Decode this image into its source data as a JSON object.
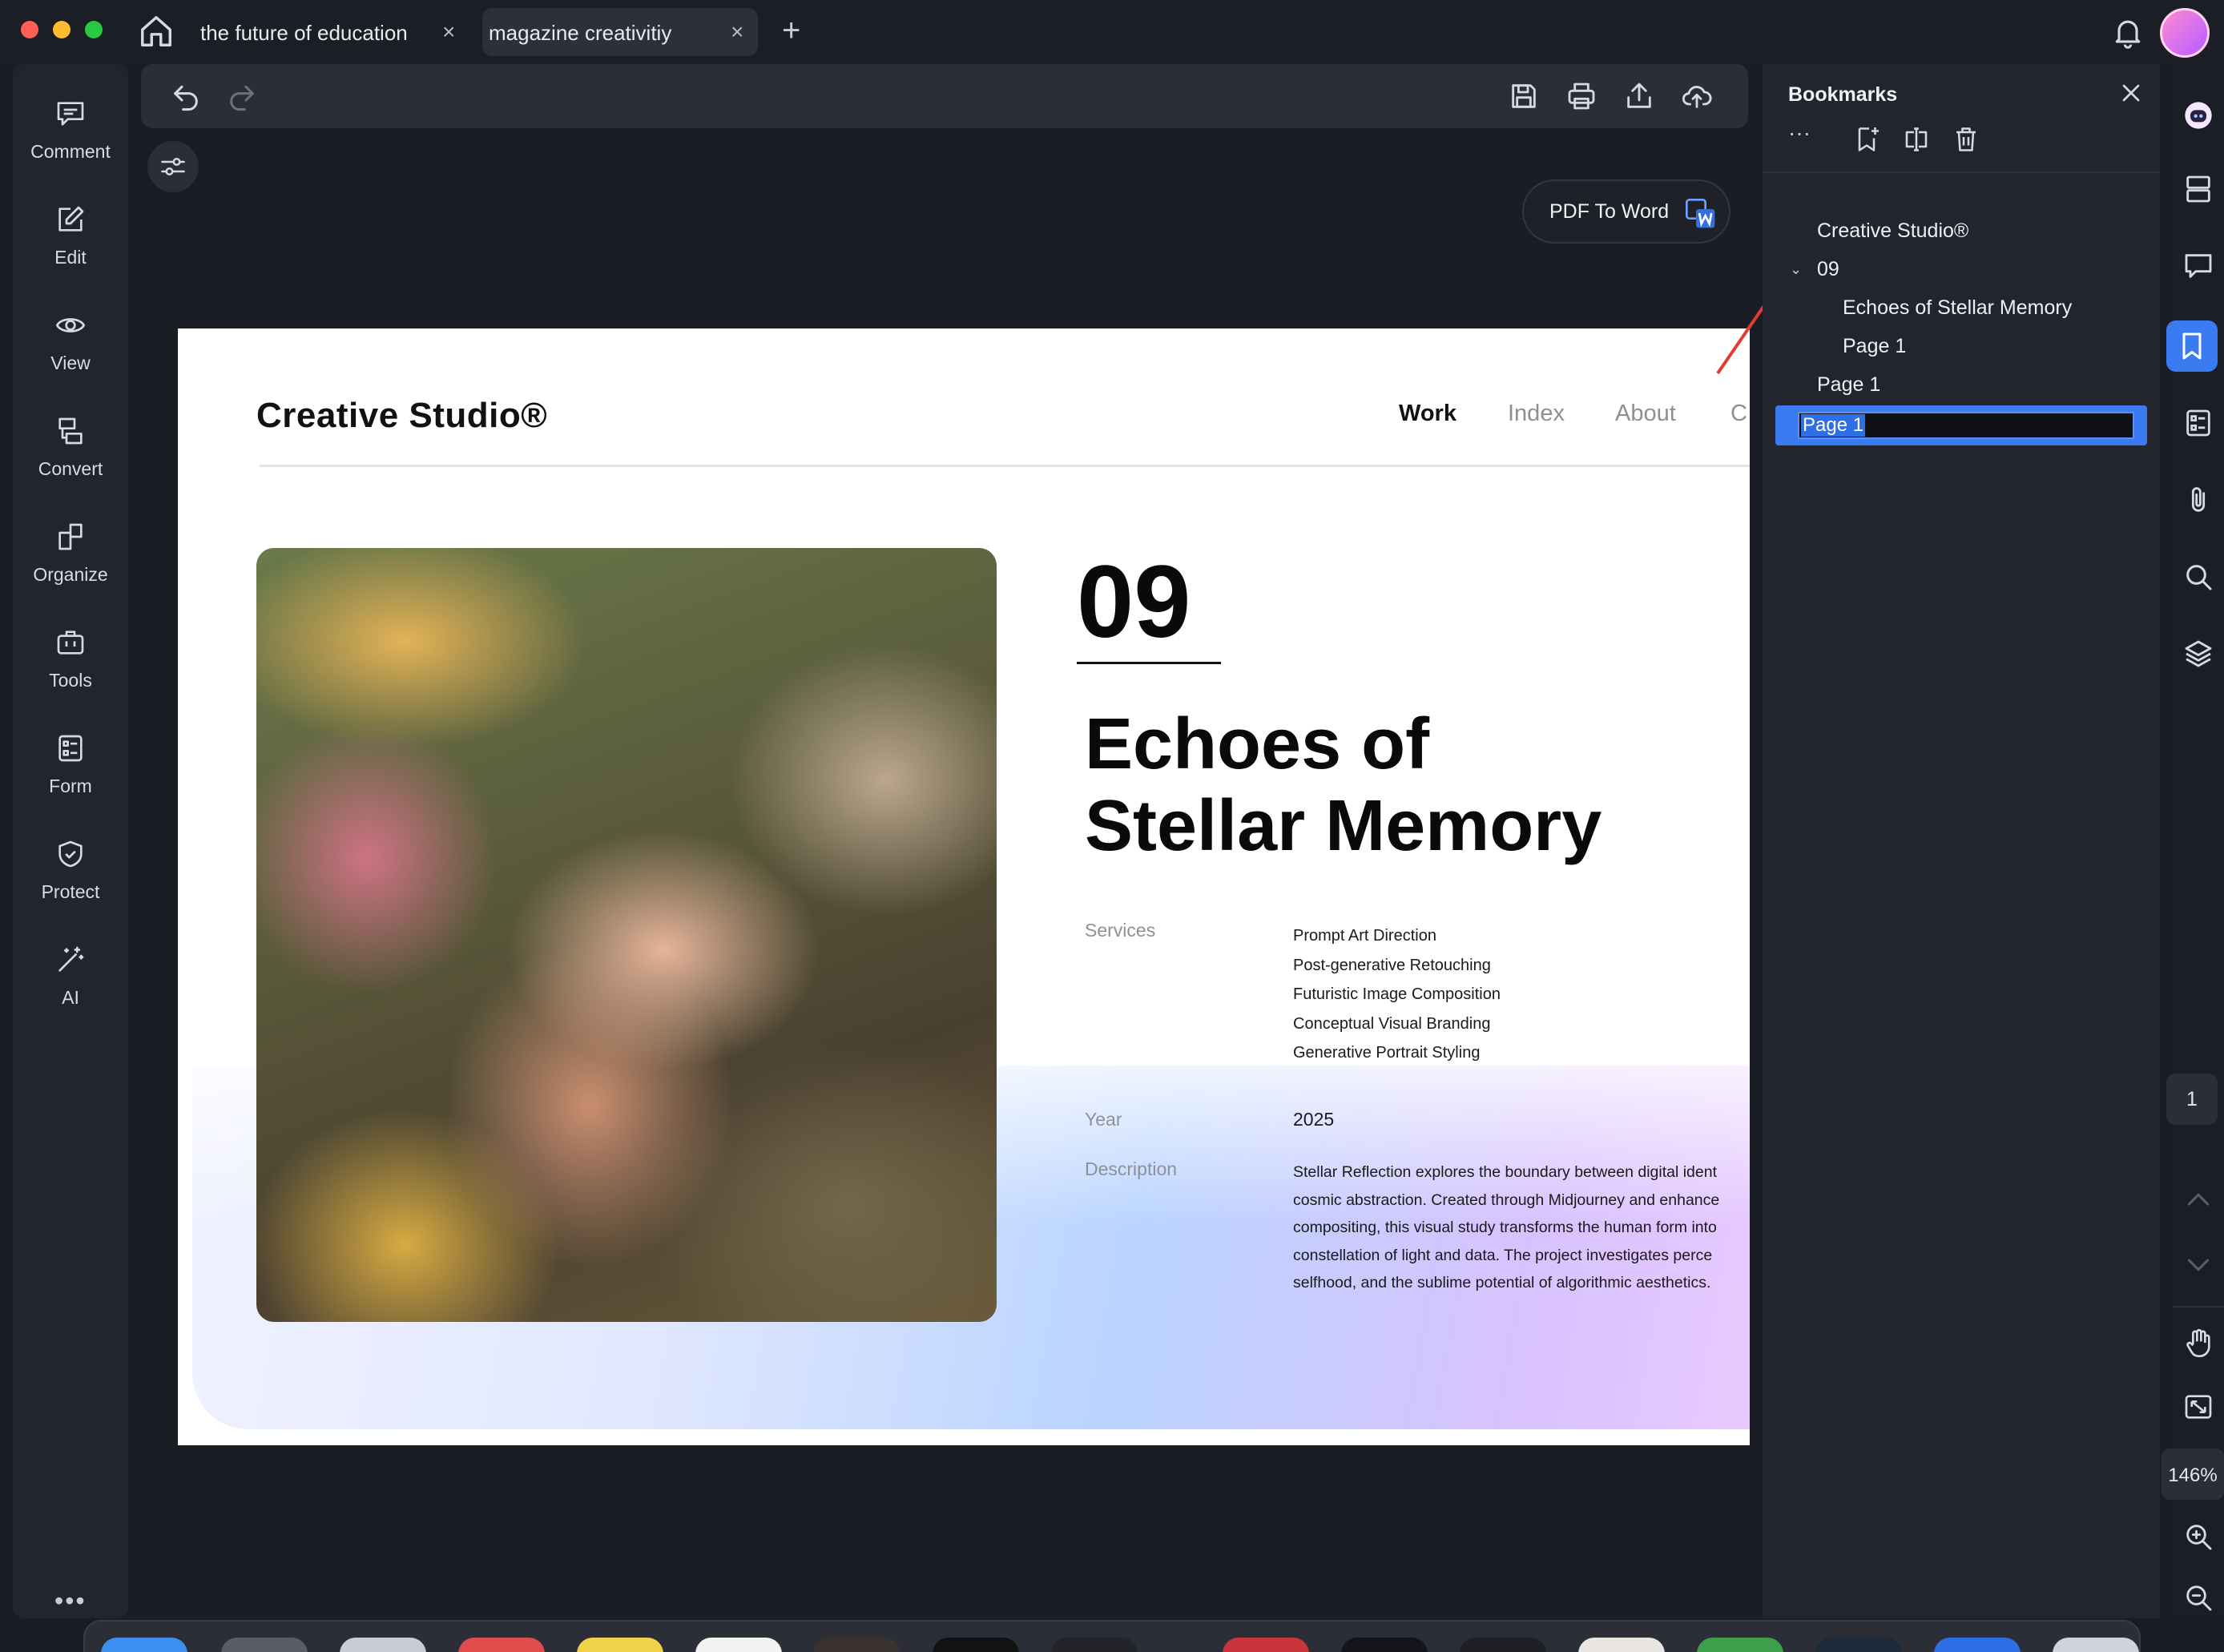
{
  "window": {
    "tabs": [
      {
        "label": "the future of education",
        "close": "×"
      },
      {
        "label": "magazine creativitiy",
        "close": "×"
      }
    ],
    "add_tab": "+"
  },
  "sidebar": {
    "items": [
      {
        "label": "Comment",
        "icon": "comment-icon"
      },
      {
        "label": "Edit",
        "icon": "edit-icon"
      },
      {
        "label": "View",
        "icon": "eye-icon"
      },
      {
        "label": "Convert",
        "icon": "convert-icon"
      },
      {
        "label": "Organize",
        "icon": "organize-icon"
      },
      {
        "label": "Tools",
        "icon": "toolbox-icon"
      },
      {
        "label": "Form",
        "icon": "form-icon"
      },
      {
        "label": "Protect",
        "icon": "shield-icon"
      },
      {
        "label": "AI",
        "icon": "magic-wand-icon"
      }
    ],
    "more": "•••"
  },
  "toolbar": {
    "pdf_to_word": "PDF To Word"
  },
  "document": {
    "brand": "Creative Studio®",
    "nav": {
      "work": "Work",
      "index": "Index",
      "about": "About",
      "c": "C"
    },
    "number": "09",
    "headline_line1": "Echoes of",
    "headline_line2": "Stellar Memory",
    "services_label": "Services",
    "services": [
      "Prompt Art Direction",
      "Post-generative Retouching",
      "Futuristic Image Composition",
      "Conceptual Visual Branding",
      "Generative Portrait Styling"
    ],
    "year_label": "Year",
    "year": "2025",
    "description_label": "Description",
    "description_lines": [
      "Stellar Reflection explores the boundary between digital ident",
      "cosmic abstraction. Created through Midjourney and enhance",
      "compositing, this visual study transforms the human form into",
      "constellation of light and data. The project investigates perce",
      "selfhood, and the sublime potential of algorithmic aesthetics."
    ]
  },
  "bookmarks": {
    "title": "Bookmarks",
    "more": "···",
    "caret": "⌄",
    "items": [
      {
        "label": "Creative Studio®",
        "level": 0
      },
      {
        "label": "09",
        "level": 0
      },
      {
        "label": "Echoes of  Stellar Memory",
        "level": 1
      },
      {
        "label": "Page 1",
        "level": 1
      },
      {
        "label": "Page 1",
        "level": 0
      }
    ],
    "editing_value": "Page 1"
  },
  "rightbar": {
    "page_number": "1",
    "zoom": "146%"
  },
  "colors": {
    "accent": "#3b7bf2",
    "annotation_arrow": "#e53935"
  }
}
